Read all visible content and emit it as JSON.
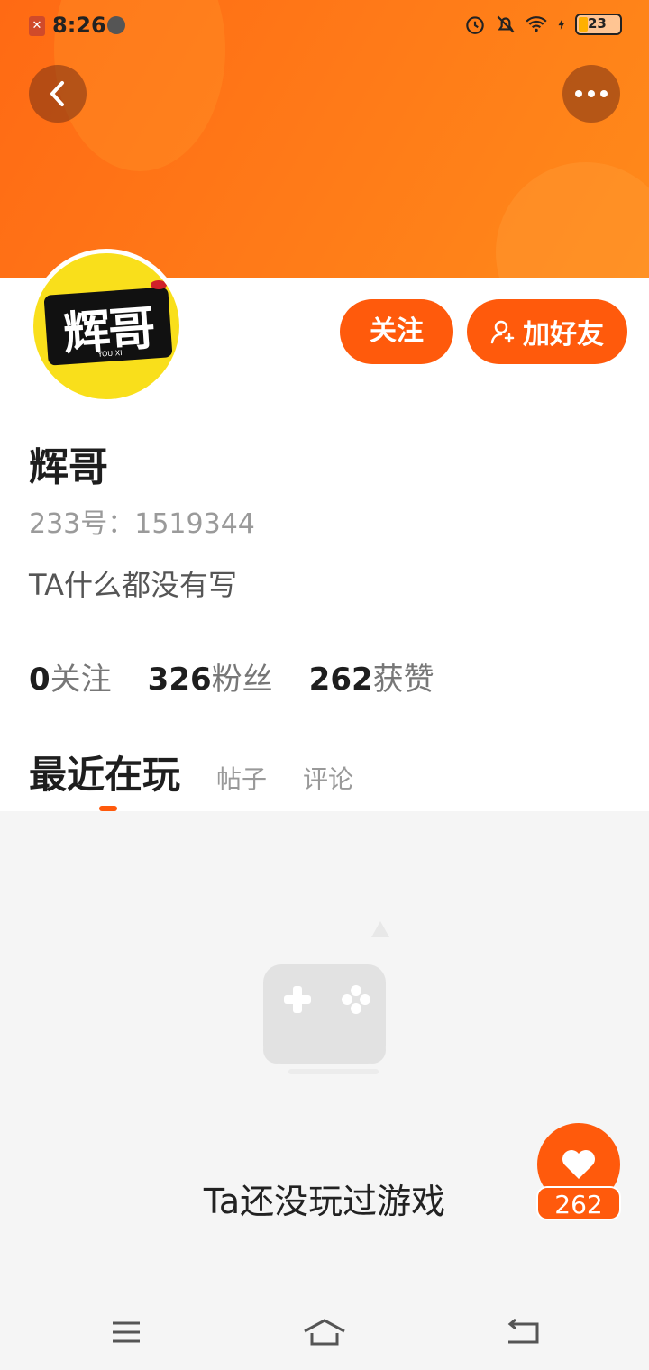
{
  "status_bar": {
    "time": "8:26",
    "battery": "23"
  },
  "profile": {
    "avatar_text": "辉哥",
    "avatar_subtext": "YOU XI",
    "name": "辉哥",
    "uid": "233号：1519344",
    "bio": "TA什么都没有写"
  },
  "actions": {
    "follow_label": "关注",
    "add_friend_label": "加好友"
  },
  "stats": [
    {
      "value": "0",
      "label": "关注"
    },
    {
      "value": "326",
      "label": "粉丝"
    },
    {
      "value": "262",
      "label": "获赞"
    }
  ],
  "tabs": [
    {
      "label": "最近在玩",
      "active": true
    },
    {
      "label": "帖子",
      "active": false
    },
    {
      "label": "评论",
      "active": false
    }
  ],
  "empty_state": {
    "message": "Ta还没玩过游戏"
  },
  "like": {
    "count": "262"
  },
  "colors": {
    "accent": "#ff5a0c",
    "banner": "#ff7a18"
  }
}
